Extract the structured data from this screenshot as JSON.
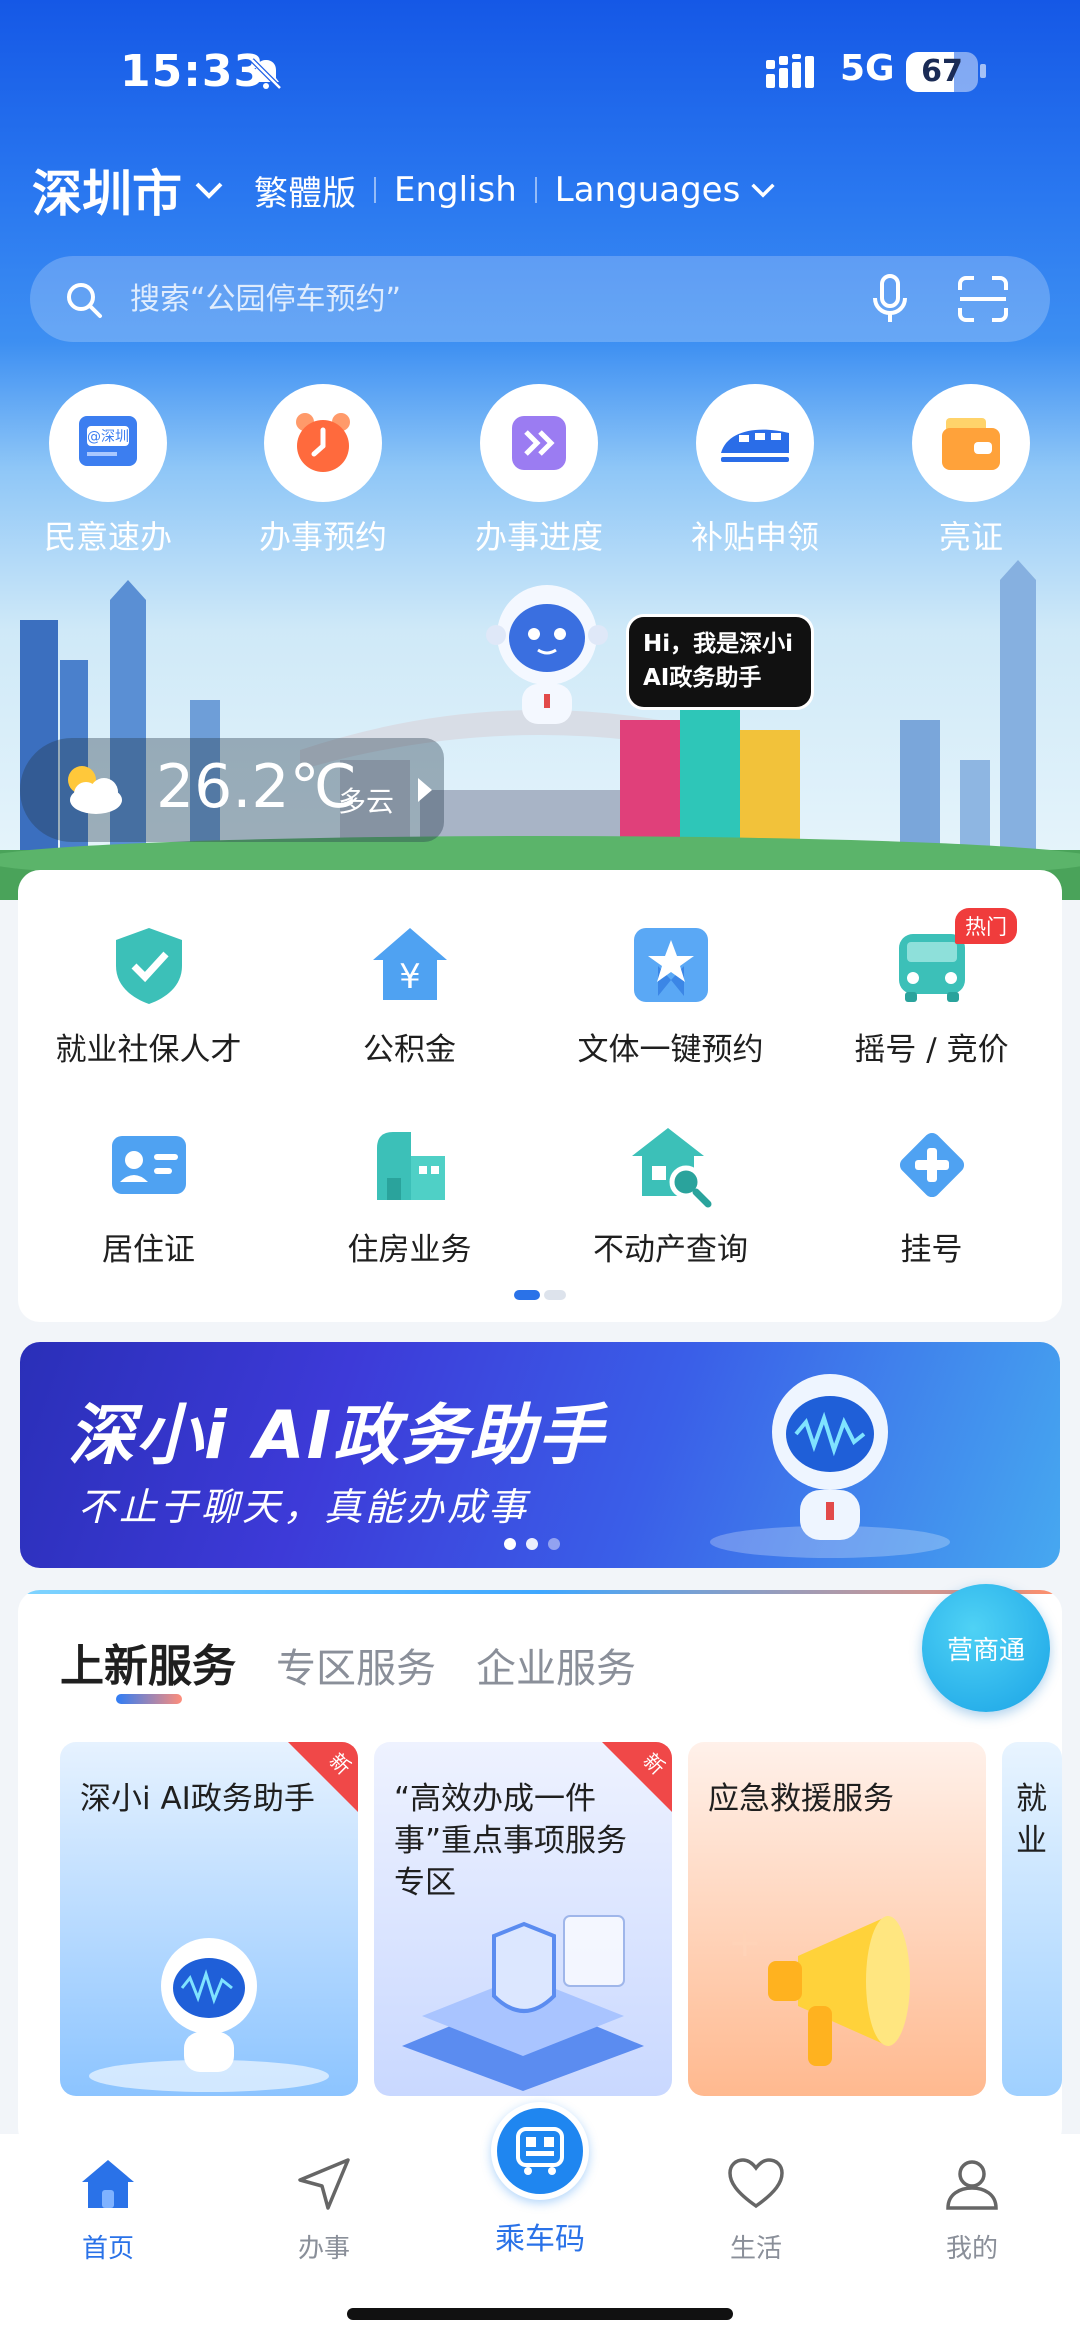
{
  "status_bar": {
    "time": "15:33",
    "network": "5G",
    "battery": "67"
  },
  "header": {
    "city": "深圳市",
    "lang_traditional": "繁體版",
    "lang_english": "English",
    "lang_more": "Languages"
  },
  "search": {
    "placeholder": "搜索“公园停车预约”"
  },
  "quick_actions": [
    {
      "label": "民意速办",
      "icon": "message-board-icon"
    },
    {
      "label": "办事预约",
      "icon": "alarm-clock-icon"
    },
    {
      "label": "办事进度",
      "icon": "progress-arrows-icon"
    },
    {
      "label": "补贴申领",
      "icon": "train-icon"
    },
    {
      "label": "亮证",
      "icon": "wallet-icon"
    }
  ],
  "assistant_bubble": {
    "line1": "Hi，我是深小i",
    "line2": "AI政务助手"
  },
  "weather": {
    "temperature": "26.2℃",
    "condition": "多云"
  },
  "service_grid": [
    {
      "label": "就业社保人才",
      "icon": "shield-check-icon"
    },
    {
      "label": "公积金",
      "icon": "house-yuan-icon"
    },
    {
      "label": "文体一键预约",
      "icon": "star-badge-icon"
    },
    {
      "label": "摇号 / 竞价",
      "icon": "car-icon",
      "badge": "热门"
    },
    {
      "label": "居住证",
      "icon": "id-card-icon"
    },
    {
      "label": "住房业务",
      "icon": "building-icon"
    },
    {
      "label": "不动产查询",
      "icon": "house-search-icon"
    },
    {
      "label": "挂号",
      "icon": "medical-cross-icon"
    }
  ],
  "banner": {
    "title": "深小i AI政务助手",
    "subtitle": "不止于聊天，真能办成事"
  },
  "services_section": {
    "tabs": [
      "上新服务",
      "专区服务",
      "企业服务"
    ],
    "float_button": "营商通",
    "cards": [
      {
        "title": "深小i AI政务助手",
        "tag": "新"
      },
      {
        "title": "“高效办成一件事”重点事项服务专区",
        "tag": "新"
      },
      {
        "title": "应急救援服务",
        "tag": ""
      },
      {
        "title": "就业",
        "tag": ""
      }
    ]
  },
  "tab_bar": {
    "home": "首页",
    "tasks": "办事",
    "ride_code": "乘车码",
    "life": "生活",
    "me": "我的"
  },
  "colors": {
    "primary": "#2a72e8",
    "hot_badge": "#f03c3c",
    "teal_icon": "#3cc0b8"
  }
}
